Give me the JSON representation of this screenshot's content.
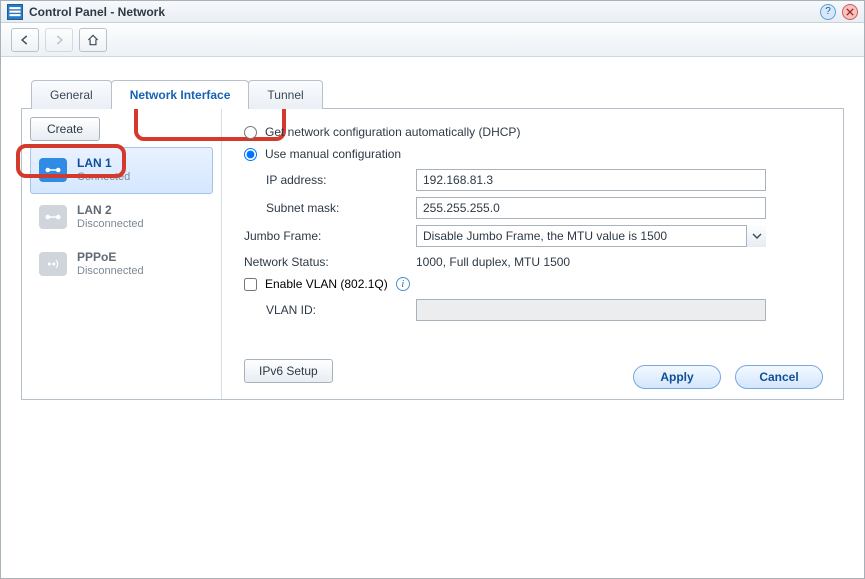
{
  "window": {
    "title": "Control Panel - Network"
  },
  "tabs": [
    {
      "label": "General"
    },
    {
      "label": "Network Interface"
    },
    {
      "label": "Tunnel"
    }
  ],
  "active_tab_index": 1,
  "toolbar": {
    "create_label": "Create"
  },
  "interfaces": [
    {
      "name": "LAN 1",
      "status": "Connected",
      "state": "connected"
    },
    {
      "name": "LAN 2",
      "status": "Disconnected",
      "state": "disconnected"
    },
    {
      "name": "PPPoE",
      "status": "Disconnected",
      "state": "disconnected"
    }
  ],
  "selected_interface_index": 0,
  "form": {
    "radio_dhcp_label": "Get network configuration automatically (DHCP)",
    "radio_manual_label": "Use manual configuration",
    "mode": "manual",
    "ip_label": "IP address:",
    "ip_value": "192.168.81.3",
    "subnet_label": "Subnet mask:",
    "subnet_value": "255.255.255.0",
    "jumbo_label": "Jumbo Frame:",
    "jumbo_value": "Disable Jumbo Frame, the MTU value is 1500",
    "netstat_label": "Network Status:",
    "netstat_value": "1000, Full duplex, MTU 1500",
    "vlan_enable_label": "Enable VLAN (802.1Q)",
    "vlan_enabled": false,
    "vlan_id_label": "VLAN ID:",
    "vlan_id_value": "",
    "ipv6_button": "IPv6 Setup"
  },
  "footer": {
    "apply": "Apply",
    "cancel": "Cancel"
  }
}
